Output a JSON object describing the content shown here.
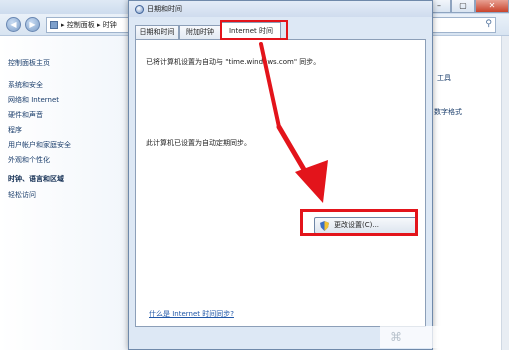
{
  "control_panel": {
    "breadcrumb_text": "▸ 控制面板 ▸ 时钟",
    "sidebar": {
      "items": [
        {
          "label": "控制面板主页",
          "bold": false
        },
        {
          "label": "系统和安全",
          "bold": false
        },
        {
          "label": "网络和 Internet",
          "bold": false
        },
        {
          "label": "硬件和声音",
          "bold": false
        },
        {
          "label": "程序",
          "bold": false
        },
        {
          "label": "用户帐户和家庭安全",
          "bold": false
        },
        {
          "label": "外观和个性化",
          "bold": false
        },
        {
          "label": "时钟、语言和区域",
          "bold": true
        },
        {
          "label": "轻松访问",
          "bold": false
        }
      ]
    },
    "right_partials": {
      "item1": "工具",
      "item2": "数字格式"
    }
  },
  "dialog": {
    "title": "日期和时间",
    "tabs": [
      {
        "label": "日期和时间",
        "active": false
      },
      {
        "label": "附加时钟",
        "active": false
      },
      {
        "label": "Internet 时间",
        "active": true
      }
    ],
    "sync_status": "已将计算机设置为自动与 \"time.windows.com\" 同步。",
    "schedule_status": "此计算机已设置为自动定期同步。",
    "change_settings_button": "更改设置(C)...",
    "help_link": "什么是 Internet 时间同步?"
  },
  "annotations": {
    "highlight_color": "#e3141b"
  },
  "icons": {
    "dialog_title_icon": "clock-icon",
    "button_icon": "shield-icon",
    "search_icon": "search-icon"
  }
}
